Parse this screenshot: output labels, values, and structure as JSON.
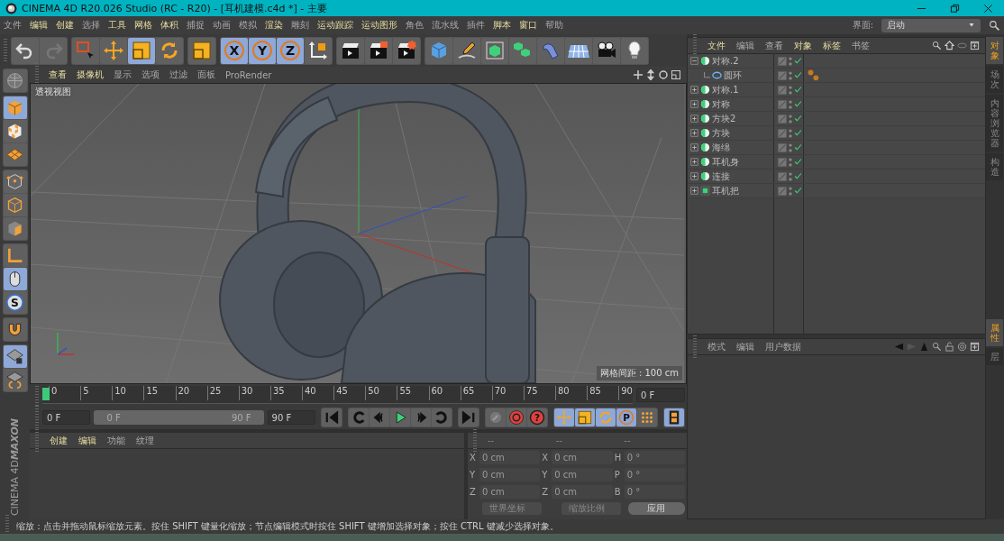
{
  "window": {
    "title": "CINEMA 4D R20.026 Studio (RC - R20) - [耳机建模.c4d *] - 主要"
  },
  "menu": [
    {
      "label": "文件",
      "highlight": false
    },
    {
      "label": "编辑",
      "highlight": true
    },
    {
      "label": "创建",
      "highlight": true
    },
    {
      "label": "选择",
      "highlight": false
    },
    {
      "label": "工具",
      "highlight": true
    },
    {
      "label": "网格",
      "highlight": true
    },
    {
      "label": "体积",
      "highlight": true
    },
    {
      "label": "捕捉",
      "highlight": false
    },
    {
      "label": "动画",
      "highlight": false
    },
    {
      "label": "模拟",
      "highlight": false
    },
    {
      "label": "渲染",
      "highlight": true
    },
    {
      "label": "雕刻",
      "highlight": false
    },
    {
      "label": "运动跟踪",
      "highlight": true
    },
    {
      "label": "运动图形",
      "highlight": true
    },
    {
      "label": "角色",
      "highlight": false
    },
    {
      "label": "流水线",
      "highlight": false
    },
    {
      "label": "插件",
      "highlight": false
    },
    {
      "label": "脚本",
      "highlight": true
    },
    {
      "label": "窗口",
      "highlight": true
    },
    {
      "label": "帮助",
      "highlight": false
    }
  ],
  "layout": {
    "label": "界面:",
    "value": "启动"
  },
  "toolbar": [
    {
      "items": [
        {
          "kind": "undo",
          "selected": false
        },
        {
          "kind": "redo",
          "selected": false
        }
      ]
    },
    {
      "items": [
        {
          "kind": "select",
          "selected": false
        },
        {
          "kind": "move",
          "selected": false
        },
        {
          "kind": "scale",
          "selected": true
        },
        {
          "kind": "rotate",
          "selected": false
        }
      ]
    },
    {
      "items": [
        {
          "kind": "scale",
          "selected": false
        }
      ]
    },
    {
      "items": [
        {
          "kind": "axis-letter",
          "label": "X",
          "selected": true
        },
        {
          "kind": "axis-letter",
          "label": "Y",
          "selected": true
        },
        {
          "kind": "axis-letter",
          "label": "Z",
          "selected": true
        },
        {
          "kind": "coord",
          "selected": false
        }
      ]
    },
    {
      "items": [
        {
          "kind": "render-view",
          "selected": false
        },
        {
          "kind": "render-picture",
          "selected": false
        },
        {
          "kind": "render-settings",
          "selected": false
        }
      ]
    },
    {
      "items": [
        {
          "kind": "cube",
          "selected": false
        },
        {
          "kind": "pen",
          "selected": false
        },
        {
          "kind": "subdiv",
          "selected": false
        },
        {
          "kind": "array",
          "selected": false
        },
        {
          "kind": "bend",
          "selected": false
        },
        {
          "kind": "floor",
          "selected": false
        },
        {
          "kind": "camera",
          "selected": false
        },
        {
          "kind": "light",
          "selected": false
        }
      ]
    }
  ],
  "left_tools": [
    {
      "items": [
        {
          "kind": "sphere",
          "selected": false
        }
      ]
    },
    {
      "items": [
        {
          "kind": "model",
          "selected": true
        },
        {
          "kind": "texture",
          "selected": false
        },
        {
          "kind": "workplane",
          "selected": false
        }
      ]
    },
    {
      "items": [
        {
          "kind": "points",
          "selected": false
        },
        {
          "kind": "edges",
          "selected": false
        },
        {
          "kind": "polys",
          "selected": false
        }
      ]
    },
    {
      "items": [
        {
          "kind": "axis",
          "selected": false
        },
        {
          "kind": "tweak",
          "selected": true
        },
        {
          "kind": "snap-letter",
          "label": "S",
          "selected": false
        }
      ]
    },
    {
      "items": [
        {
          "kind": "magnet",
          "selected": false
        }
      ]
    },
    {
      "items": [
        {
          "kind": "gridlock",
          "selected": true
        },
        {
          "kind": "gridanim",
          "selected": false
        }
      ]
    }
  ],
  "logo": {
    "brand": "MAXON",
    "product": "CINEMA 4D"
  },
  "viewport": {
    "menu": [
      {
        "label": "查看",
        "highlight": true
      },
      {
        "label": "摄像机",
        "highlight": true
      },
      {
        "label": "显示",
        "highlight": false
      },
      {
        "label": "选项",
        "highlight": false
      },
      {
        "label": "过滤",
        "highlight": false
      },
      {
        "label": "面板",
        "highlight": false
      },
      {
        "label": "ProRender",
        "highlight": false
      }
    ],
    "view_name": "透视视图",
    "grid_spacing": "网格间距 : 100 cm"
  },
  "timeline": {
    "ticks": [
      "0",
      "5",
      "10",
      "15",
      "20",
      "25",
      "30",
      "35",
      "40",
      "45",
      "50",
      "55",
      "60",
      "65",
      "70",
      "75",
      "80",
      "85",
      "90"
    ],
    "playhead": {
      "level": 0
    },
    "current": "0 F",
    "start": "0 F",
    "range_start": "0 F",
    "range_end": "90 F",
    "range": {
      "level": 1
    },
    "end": "90 F"
  },
  "transport": [
    {
      "items": [
        {
          "kind": "skip-start",
          "selected": false
        }
      ]
    },
    {
      "items": [
        {
          "kind": "prev-key",
          "selected": false
        },
        {
          "kind": "prev-frame",
          "selected": false
        },
        {
          "kind": "play",
          "selected": false
        },
        {
          "kind": "next-frame",
          "selected": false
        },
        {
          "kind": "next-key",
          "selected": false
        }
      ]
    },
    {
      "items": [
        {
          "kind": "skip-end",
          "selected": false
        }
      ]
    },
    {
      "items": [
        {
          "kind": "key",
          "selected": false
        },
        {
          "kind": "record",
          "selected": false
        },
        {
          "kind": "red-letter",
          "label": "?",
          "selected": false
        }
      ]
    },
    {
      "items": [
        {
          "kind": "move",
          "selected": true
        },
        {
          "kind": "scale",
          "selected": true
        },
        {
          "kind": "rotate",
          "selected": true
        },
        {
          "kind": "param-letter",
          "label": "P",
          "selected": true
        },
        {
          "kind": "dots",
          "selected": false
        }
      ]
    },
    {
      "items": [
        {
          "kind": "film",
          "selected": true
        }
      ]
    }
  ],
  "material_manager": {
    "menu": [
      {
        "label": "创建",
        "highlight": true
      },
      {
        "label": "编辑",
        "highlight": true
      },
      {
        "label": "功能",
        "highlight": false
      },
      {
        "label": "纹理",
        "highlight": false
      }
    ]
  },
  "coordinates": {
    "headers": [
      "--",
      "--",
      "--"
    ],
    "rows": [
      [
        {
          "axis": "X",
          "value": "0 cm"
        },
        {
          "axis": "X",
          "value": "0 cm"
        },
        {
          "axis": "H",
          "value": "0 °"
        }
      ],
      [
        {
          "axis": "Y",
          "value": "0 cm"
        },
        {
          "axis": "Y",
          "value": "0 cm"
        },
        {
          "axis": "P",
          "value": "0 °"
        }
      ],
      [
        {
          "axis": "Z",
          "value": "0 cm"
        },
        {
          "axis": "Z",
          "value": "0 cm"
        },
        {
          "axis": "B",
          "value": "0 °"
        }
      ]
    ],
    "dropdowns": [
      "世界坐标",
      "缩放比例"
    ],
    "apply": "应用"
  },
  "object_manager": {
    "menu": [
      {
        "label": "文件",
        "highlight": true
      },
      {
        "label": "编辑",
        "highlight": false
      },
      {
        "label": "查看",
        "highlight": false
      },
      {
        "label": "对象",
        "highlight": true
      },
      {
        "label": "标签",
        "highlight": true
      },
      {
        "label": "书签",
        "highlight": false
      }
    ],
    "objects": [
      {
        "name": "对称.2",
        "kind": "symmetry",
        "expanded": true,
        "enabled": true,
        "has_tag": false,
        "children": [
          {
            "name": "圆环",
            "kind": "torus",
            "enabled": true,
            "has_tag": true
          }
        ]
      },
      {
        "name": "对称.1",
        "kind": "symmetry",
        "expanded": false,
        "enabled": true,
        "has_tag": false
      },
      {
        "name": "对称",
        "kind": "symmetry",
        "expanded": false,
        "enabled": true,
        "has_tag": false
      },
      {
        "name": "方块2",
        "kind": "symmetry",
        "expanded": false,
        "enabled": true,
        "has_tag": false
      },
      {
        "name": "方块",
        "kind": "symmetry",
        "expanded": false,
        "enabled": true,
        "has_tag": false
      },
      {
        "name": "海绵",
        "kind": "symmetry",
        "expanded": false,
        "enabled": true,
        "has_tag": false
      },
      {
        "name": "耳机身",
        "kind": "symmetry",
        "expanded": false,
        "enabled": true,
        "has_tag": false
      },
      {
        "name": "连接",
        "kind": "symmetry",
        "expanded": false,
        "enabled": true,
        "has_tag": false
      },
      {
        "name": "耳机把",
        "kind": "subdiv",
        "expanded": false,
        "enabled": true,
        "has_tag": false
      }
    ]
  },
  "attributes": {
    "menu": [
      {
        "label": "模式",
        "highlight": false
      },
      {
        "label": "编辑",
        "highlight": false
      },
      {
        "label": "用户数据",
        "highlight": false
      }
    ]
  },
  "side_tabs_top": [
    {
      "label": "对象",
      "selected": true
    },
    {
      "label": "场次",
      "selected": false
    },
    {
      "label": "内容浏览器",
      "selected": false
    },
    {
      "label": "构造",
      "selected": false
    }
  ],
  "side_tabs_bottom": [
    {
      "label": "属性",
      "selected": true
    },
    {
      "label": "层",
      "selected": false
    }
  ],
  "status_bar": "缩放：点击并拖动鼠标缩放元素。按住 SHIFT 键量化缩放；节点编辑模式时按住 SHIFT 键增加选择对象；按住 CTRL 键减少选择对象。"
}
